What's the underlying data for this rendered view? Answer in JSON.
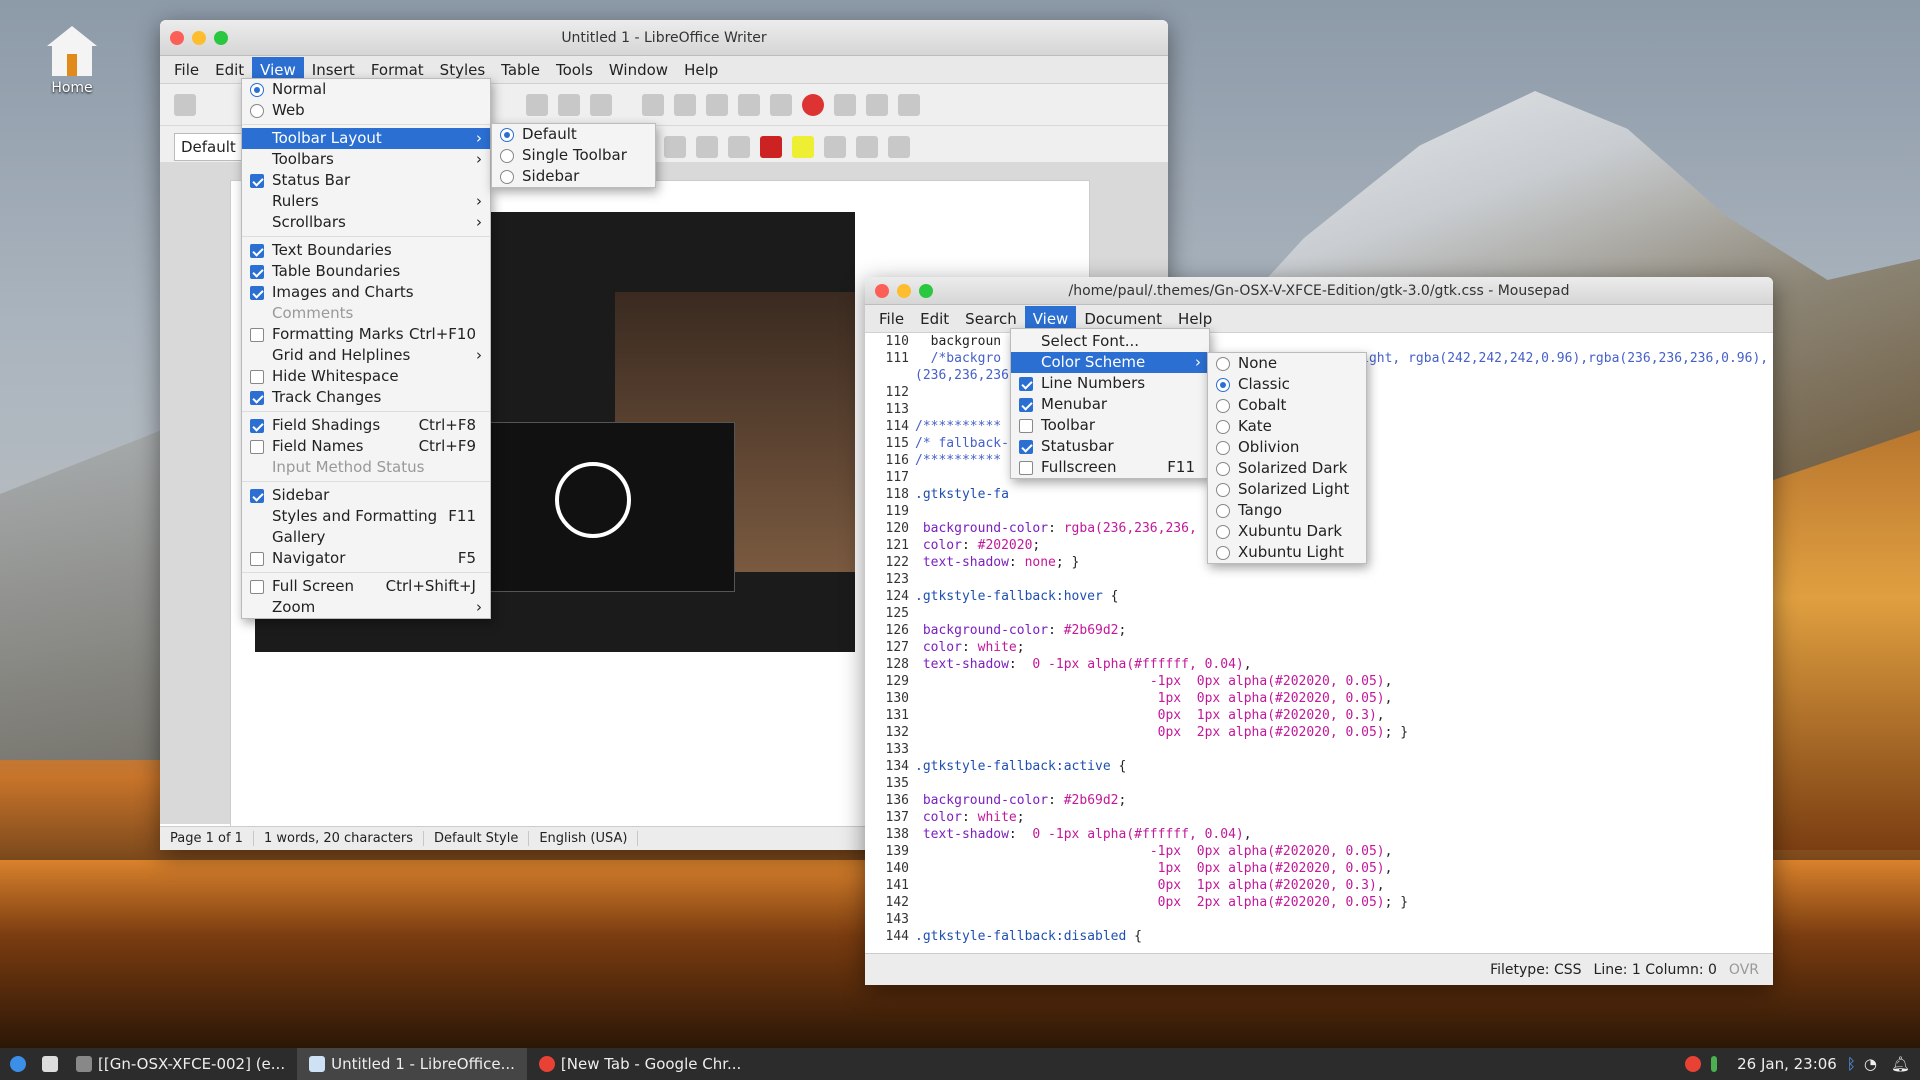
{
  "desktop": {
    "home_label": "Home"
  },
  "writer": {
    "title": "Untitled 1 - LibreOffice Writer",
    "menu": [
      "File",
      "Edit",
      "View",
      "Insert",
      "Format",
      "Styles",
      "Table",
      "Tools",
      "Window",
      "Help"
    ],
    "style_box": "Default Style",
    "status": [
      "Page 1 of 1",
      "1 words, 20 characters",
      "Default Style",
      "English (USA)"
    ]
  },
  "view_menu": {
    "items": [
      {
        "label": "Normal",
        "type": "radio",
        "on": true
      },
      {
        "label": "Web",
        "type": "radio",
        "on": false
      },
      {
        "sep": true
      },
      {
        "label": "Toolbar Layout",
        "sub": true,
        "selected": true
      },
      {
        "label": "Toolbars",
        "sub": true
      },
      {
        "label": "Status Bar",
        "type": "check",
        "on": true
      },
      {
        "label": "Rulers",
        "sub": true
      },
      {
        "label": "Scrollbars",
        "sub": true
      },
      {
        "sep": true
      },
      {
        "label": "Text Boundaries",
        "type": "check",
        "on": true
      },
      {
        "label": "Table Boundaries",
        "type": "check",
        "on": true
      },
      {
        "label": "Images and Charts",
        "type": "check",
        "on": true
      },
      {
        "label": "Comments",
        "disabled": true
      },
      {
        "label": "Formatting Marks",
        "type": "check",
        "on": false,
        "shortcut": "Ctrl+F10"
      },
      {
        "label": "Grid and Helplines",
        "sub": true
      },
      {
        "label": "Hide Whitespace",
        "type": "check",
        "on": false
      },
      {
        "label": "Track Changes",
        "type": "check",
        "on": true
      },
      {
        "sep": true
      },
      {
        "label": "Field Shadings",
        "type": "check",
        "on": true,
        "shortcut": "Ctrl+F8"
      },
      {
        "label": "Field Names",
        "type": "check",
        "on": false,
        "shortcut": "Ctrl+F9"
      },
      {
        "label": "Input Method Status",
        "disabled": true
      },
      {
        "sep": true
      },
      {
        "label": "Sidebar",
        "type": "check",
        "on": true
      },
      {
        "label": "Styles and Formatting",
        "shortcut": "F11"
      },
      {
        "label": "Gallery"
      },
      {
        "label": "Navigator",
        "type": "check",
        "on": false,
        "shortcut": "F5"
      },
      {
        "sep": true
      },
      {
        "label": "Full Screen",
        "type": "check",
        "on": false,
        "shortcut": "Ctrl+Shift+J"
      },
      {
        "label": "Zoom",
        "sub": true
      }
    ]
  },
  "toolbar_layout_menu": {
    "items": [
      {
        "label": "Default",
        "on": true
      },
      {
        "label": "Single Toolbar",
        "on": false
      },
      {
        "label": "Sidebar",
        "on": false
      }
    ]
  },
  "mousepad": {
    "title": "/home/paul/.themes/Gn-OSX-V-XFCE-Edition/gtk-3.0/gtk.css - Mousepad",
    "menu": [
      "File",
      "Edit",
      "Search",
      "View",
      "Document",
      "Help"
    ],
    "status": {
      "filetype": "Filetype: CSS",
      "position": "Line: 1 Column: 0",
      "ovr": "OVR"
    }
  },
  "mp_view_menu": {
    "items": [
      {
        "label": "Select Font..."
      },
      {
        "label": "Color Scheme",
        "sub": true,
        "selected": true
      },
      {
        "label": "Line Numbers",
        "type": "check",
        "on": true
      },
      {
        "label": "Menubar",
        "type": "check",
        "on": true
      },
      {
        "label": "Toolbar",
        "type": "check",
        "on": false
      },
      {
        "label": "Statusbar",
        "type": "check",
        "on": true
      },
      {
        "label": "Fullscreen",
        "type": "check",
        "on": false,
        "shortcut": "F11"
      }
    ]
  },
  "color_scheme_menu": {
    "items": [
      {
        "label": "None",
        "on": false
      },
      {
        "label": "Classic",
        "on": true
      },
      {
        "label": "Cobalt",
        "on": false
      },
      {
        "label": "Kate",
        "on": false
      },
      {
        "label": "Oblivion",
        "on": false
      },
      {
        "label": "Solarized Dark",
        "on": false
      },
      {
        "label": "Solarized Light",
        "on": false
      },
      {
        "label": "Tango",
        "on": false
      },
      {
        "label": "Xubuntu Dark",
        "on": false
      },
      {
        "label": "Xubuntu Light",
        "on": false
      }
    ]
  },
  "taskbar": {
    "tasks": [
      "[[Gn-OSX-XFCE-002] (e...",
      "Untitled 1 - LibreOffice...",
      "[New Tab - Google Chr..."
    ],
    "clock": "26 Jan, 23:06"
  }
}
